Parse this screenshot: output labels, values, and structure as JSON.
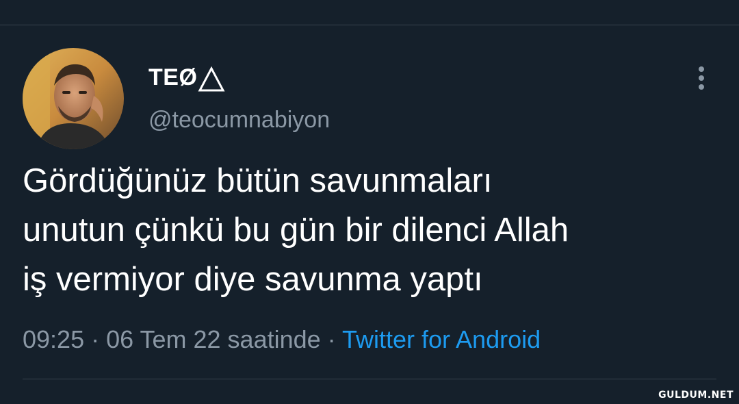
{
  "tweet": {
    "author": {
      "display_name": "TEØ",
      "name_icon": "triangle-icon",
      "handle": "@teocumnabiyon",
      "avatar": "profile-photo"
    },
    "more_icon": "more-vertical-icon",
    "text_lines": [
      "Gördüğünüz bütün savunmaları",
      "unutun çünkü bu gün bir dilenci Allah",
      "iş vermiyor diye savunma yaptı"
    ],
    "meta": {
      "time": "09:25",
      "separator": " · ",
      "date": "06 Tem 22 saatinde",
      "source": "Twitter for Android"
    }
  },
  "watermark": "GULDUM.NET",
  "colors": {
    "background": "#15202b",
    "text": "#ffffff",
    "secondary": "#8b98a5",
    "link": "#1d9bf0",
    "divider": "#38444d"
  }
}
